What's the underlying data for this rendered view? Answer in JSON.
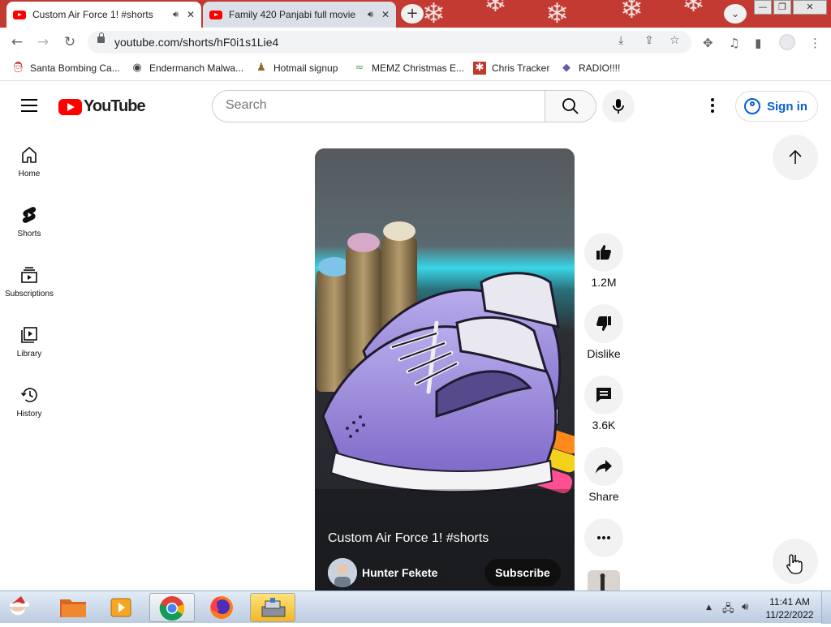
{
  "browser": {
    "tabs": [
      {
        "title": "Custom Air Force 1! #shorts",
        "audio_icon": "🔊︎",
        "close": "✕",
        "active": true
      },
      {
        "title": "Family 420 Panjabi full movie",
        "audio_icon": "🔊︎",
        "close": "✕",
        "active": false
      }
    ],
    "new_tab": "+",
    "tab_dropdown": "⌄",
    "window": {
      "minimize": "—",
      "restore": "❐",
      "close": "✕"
    },
    "nav": {
      "back": "←",
      "forward": "→",
      "reload": "↻"
    },
    "url": "youtube.com/shorts/hF0i1s1Lie4",
    "omnibox_icons": {
      "install": "⤓",
      "share": "⇪",
      "bookmark": "☆"
    },
    "toolbar_icons": {
      "extensions": "✥",
      "media": "♫",
      "side_panel": "▮",
      "menu": "⋮"
    }
  },
  "bookmarks": [
    {
      "label": "Santa Bombing Ca...",
      "icon": "santa-icon",
      "glyph": "🎅︎"
    },
    {
      "label": "Endermanch Malwa...",
      "icon": "raccoon-icon",
      "glyph": "◉"
    },
    {
      "label": "Hotmail signup",
      "icon": "figure-icon",
      "glyph": "♟"
    },
    {
      "label": "MEMZ Christmas E...",
      "icon": "nyan-icon",
      "glyph": "≈"
    },
    {
      "label": "Chris Tracker",
      "icon": "star-box-icon",
      "glyph": "✱"
    },
    {
      "label": "RADIO!!!!",
      "icon": "diamond-icon",
      "glyph": "◆"
    }
  ],
  "youtube": {
    "logo_text": "YouTube",
    "search_placeholder": "Search",
    "sign_in": "Sign in",
    "guide": [
      {
        "label": "Home",
        "icon": "home-icon"
      },
      {
        "label": "Shorts",
        "icon": "shorts-icon"
      },
      {
        "label": "Subscriptions",
        "icon": "subscriptions-icon"
      },
      {
        "label": "Library",
        "icon": "library-icon"
      },
      {
        "label": "History",
        "icon": "history-icon"
      }
    ],
    "short": {
      "title": "Custom Air Force 1! #shorts",
      "channel": "Hunter Fekete",
      "subscribe": "Subscribe"
    },
    "actions": {
      "likes": "1.2M",
      "dislike": "Dislike",
      "comments": "3.6K",
      "share": "Share"
    }
  },
  "taskbar": {
    "apps": [
      "santa-icon",
      "folder-icon",
      "media-player-icon",
      "chrome-icon",
      "firefox-icon",
      "installer-icon"
    ],
    "time": "11:41 AM",
    "date": "11/22/2022",
    "tray": {
      "up": "▲",
      "network": "🖧︎",
      "volume": "🔊︎"
    }
  },
  "colors": {
    "tabstrip": "#c23a32",
    "youtube_red": "#ff0000",
    "link_blue": "#065fd4",
    "shoe_purple": "#9b8ad6"
  }
}
